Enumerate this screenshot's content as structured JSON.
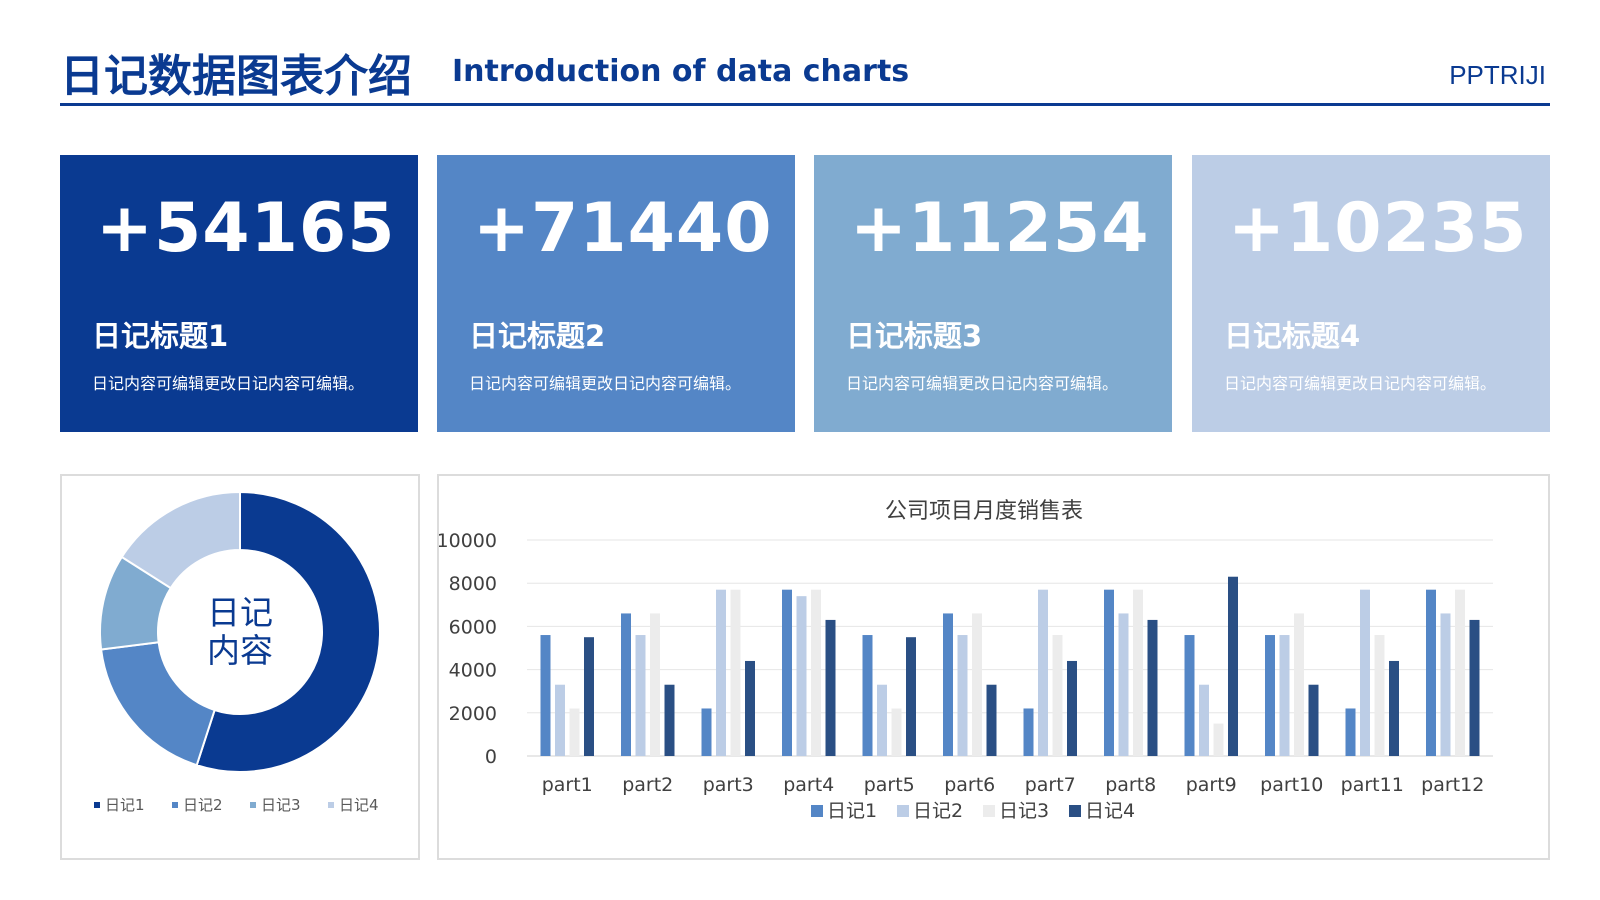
{
  "header": {
    "title_cn": "日记数据图表介绍",
    "title_en": "Introduction of data charts",
    "brand": "PPTRIJI"
  },
  "colors": {
    "primary": "#0a3a91",
    "card1": "#0a3a91",
    "card2": "#5486c6",
    "card3": "#80abd0",
    "card4": "#bccde6",
    "series1": "#5486c6",
    "series2": "#bccde6",
    "series3": "#ececec",
    "series4": "#2a4f84"
  },
  "cards": [
    {
      "value": "+54165",
      "title": "日记标题1",
      "desc": "日记内容可编辑更改日记内容可编辑。"
    },
    {
      "value": "+71440",
      "title": "日记标题2",
      "desc": "日记内容可编辑更改日记内容可编辑。"
    },
    {
      "value": "+11254",
      "title": "日记标题3",
      "desc": "日记内容可编辑更改日记内容可编辑。"
    },
    {
      "value": "+10235",
      "title": "日记标题4",
      "desc": "日记内容可编辑更改日记内容可编辑。"
    }
  ],
  "chart_data": [
    {
      "type": "pie",
      "center_label": [
        "日记",
        "内容"
      ],
      "labels": [
        "日记1",
        "日记2",
        "日记3",
        "日记4"
      ],
      "values": [
        55,
        18,
        11,
        16
      ],
      "colors": [
        "#0a3a91",
        "#5486c6",
        "#80abd0",
        "#bccde6"
      ],
      "legend": "bottom"
    },
    {
      "type": "bar",
      "title": "公司项目月度销售表",
      "categories": [
        "part1",
        "part2",
        "part3",
        "part4",
        "part5",
        "part6",
        "part7",
        "part8",
        "part9",
        "part10",
        "part11",
        "part12"
      ],
      "series": [
        {
          "name": "日记1",
          "color": "#5486c6",
          "values": [
            5600,
            6600,
            2200,
            7700,
            5600,
            6600,
            2200,
            7700,
            5600,
            5600,
            2200,
            7700
          ]
        },
        {
          "name": "日记2",
          "color": "#bccde6",
          "values": [
            3300,
            5600,
            7700,
            7400,
            3300,
            5600,
            7700,
            6600,
            3300,
            5600,
            7700,
            6600
          ]
        },
        {
          "name": "日记3",
          "color": "#ececec",
          "values": [
            2200,
            6600,
            7700,
            7700,
            2200,
            6600,
            5600,
            7700,
            1500,
            6600,
            5600,
            7700
          ]
        },
        {
          "name": "日记4",
          "color": "#2a4f84",
          "values": [
            5500,
            3300,
            4400,
            6300,
            5500,
            3300,
            4400,
            6300,
            8300,
            3300,
            4400,
            6300
          ]
        }
      ],
      "yticks": [
        "0",
        "2000",
        "4000",
        "6000",
        "8000",
        "10000"
      ],
      "ylim": [
        0,
        10000
      ],
      "grid": true,
      "legend": "bottom"
    }
  ]
}
